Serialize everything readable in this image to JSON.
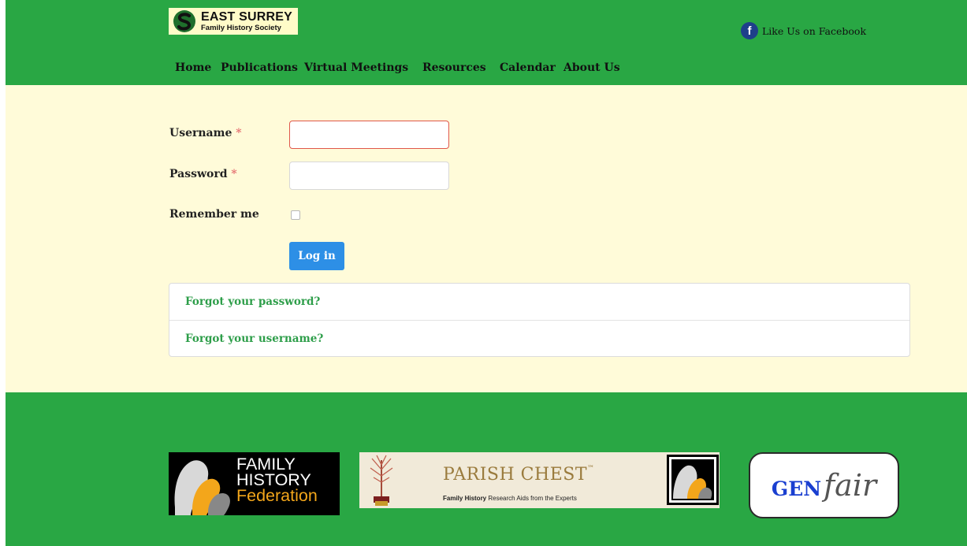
{
  "header": {
    "logo": {
      "line1": "EAST SURREY",
      "line2": "Family History Society",
      "icon": "s-monogram-icon"
    },
    "facebook": {
      "label": "Like Us on Facebook",
      "icon": "facebook-icon"
    },
    "nav": [
      {
        "label": "Home"
      },
      {
        "label": "Publications"
      },
      {
        "label": "Virtual Meetings"
      },
      {
        "label": "Resources"
      },
      {
        "label": "Calendar"
      },
      {
        "label": "About Us"
      }
    ]
  },
  "login_form": {
    "username": {
      "label": "Username",
      "required_mark": "*",
      "value": ""
    },
    "password": {
      "label": "Password",
      "required_mark": "*",
      "value": ""
    },
    "remember": {
      "label": "Remember me",
      "checked": false
    },
    "submit_label": "Log in"
  },
  "help_links": [
    {
      "label": "Forgot your password?"
    },
    {
      "label": "Forgot your username?"
    }
  ],
  "footer": {
    "fhf": {
      "line1": "FAMILY",
      "line2": "HISTORY",
      "line3": "Federation"
    },
    "parish_chest": {
      "title": "PARISH CHEST",
      "tm": "™",
      "sub_bold": "Family History",
      "sub_rest": " Research Aids from the Experts"
    },
    "genfair": {
      "part1": "GEN",
      "part2": "fair"
    }
  },
  "colors": {
    "header_green": "#29a744",
    "main_bg": "#fffbd9",
    "link_green": "#2e9e4a",
    "button_blue": "#2d8fe6",
    "required_red": "#e57373"
  }
}
